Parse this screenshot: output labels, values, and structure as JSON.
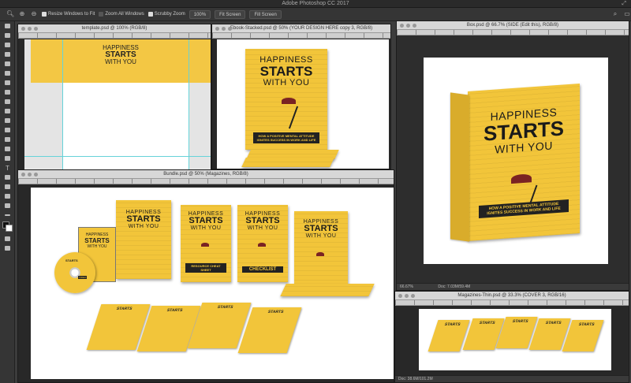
{
  "app": {
    "title": "Adobe Photoshop CC 2017"
  },
  "options_bar": {
    "resize_windows": "Resize Windows to Fit",
    "zoom_all": "Zoom All Windows",
    "scrubby_zoom": "Scrubby Zoom",
    "zoom_value": "100%",
    "fit_screen": "Fit Screen",
    "fill_screen": "Fill Screen"
  },
  "windows": {
    "template": {
      "title": "template.psd @ 100% (RGB/8)"
    },
    "ebook": {
      "title": "Ebook-Stacked.psd @ 50% (YOUR DESIGN HERE copy 3, RGB/8)"
    },
    "box": {
      "title": "Box.psd @ 66.7% (SIDE (Edit this), RGB/8)",
      "zoom": "66.67%",
      "doc": "Doc: 7.03M/59.4M"
    },
    "bundle": {
      "title": "Bundle.psd @ 50% (Magazines, RGB/8)"
    },
    "magazines": {
      "title": "Magazines-Thin.psd @ 33.3% (COVER 3, RGB/16)",
      "doc": "Doc: 38.6M/101.2M"
    }
  },
  "book": {
    "line1": "HAPPINESS",
    "line2": "STARTS",
    "line3": "WITH YOU",
    "tagline": "HOW A POSITIVE MENTAL ATTITUDE IGNITES SUCCESS IN WORK AND LIFE",
    "resource": "RESOURCE CHEAT SHEET",
    "checklist": "CHECKLIST",
    "video": "VIDEO"
  },
  "colors": {
    "cover": "#f2c53a",
    "dark": "#222222",
    "umbrella": "#7a2323"
  }
}
